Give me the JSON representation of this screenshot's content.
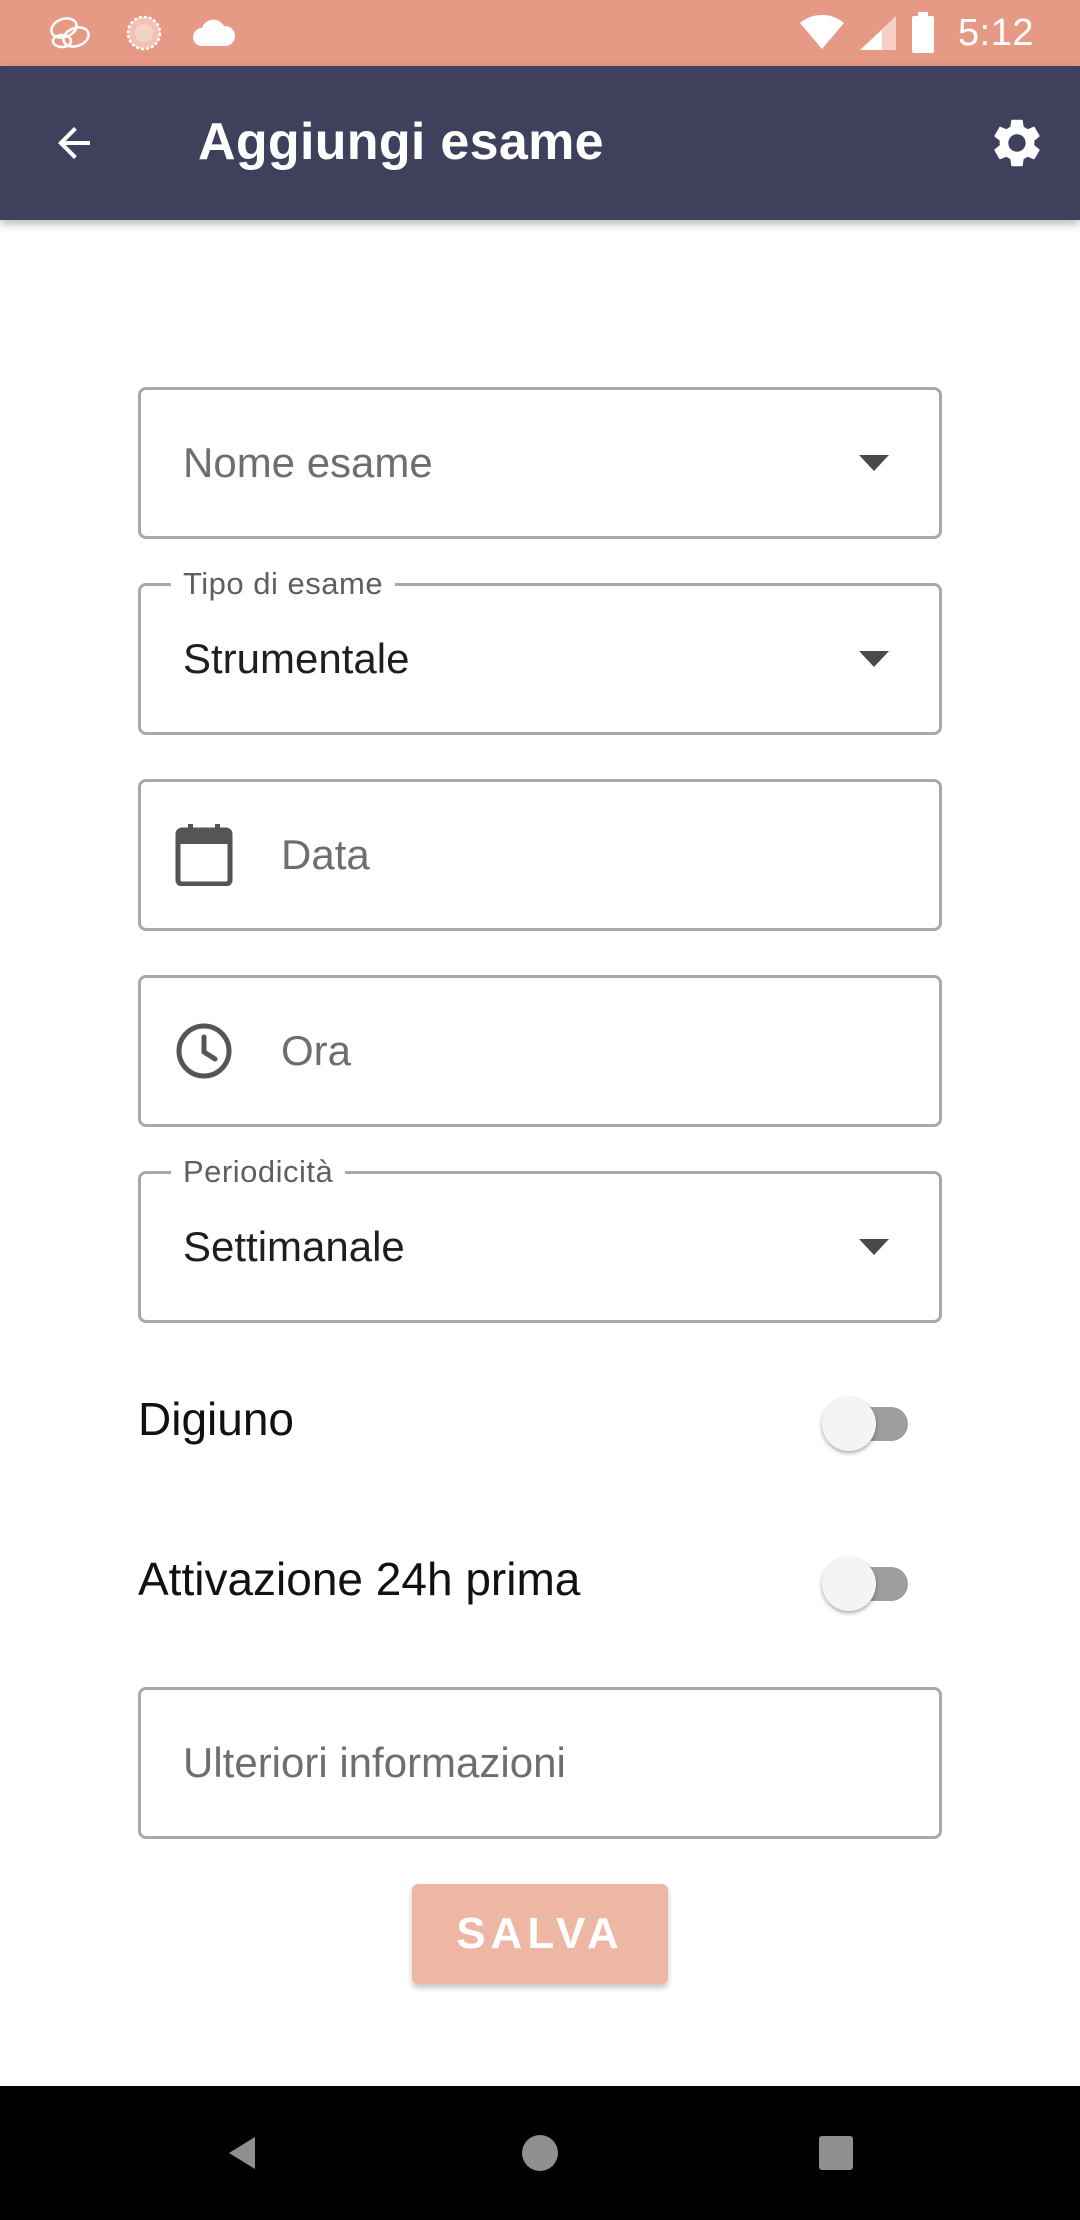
{
  "status_bar": {
    "time": "5:12",
    "left_icons": [
      "app-notification-icon",
      "sun-icon",
      "cloud-icon"
    ],
    "right_icons": [
      "wifi-icon",
      "cellular-signal-icon",
      "battery-icon"
    ]
  },
  "app_bar": {
    "title": "Aggiungi esame",
    "back_icon": "arrow-back-icon",
    "settings_icon": "gear-icon"
  },
  "form": {
    "exam_name": {
      "placeholder": "Nome esame",
      "value": ""
    },
    "exam_type": {
      "label": "Tipo di esame",
      "value": "Strumentale"
    },
    "date": {
      "placeholder": "Data",
      "icon": "calendar-icon"
    },
    "time": {
      "placeholder": "Ora",
      "icon": "clock-icon"
    },
    "periodicity": {
      "label": "Periodicità",
      "value": "Settimanale"
    },
    "fasting": {
      "label": "Digiuno",
      "checked": false
    },
    "activation_24h": {
      "label": "Attivazione 24h prima",
      "checked": false
    },
    "notes": {
      "placeholder": "Ulteriori informazioni",
      "value": ""
    },
    "save_label": "SALVA"
  },
  "colors": {
    "status_bar": "#e69a85",
    "app_bar": "#3e405c",
    "save_button": "#edb7a3",
    "field_border": "#a9a9a9"
  },
  "nav_bar": {
    "icons": [
      "back-triangle-icon",
      "home-circle-icon",
      "recents-square-icon"
    ]
  }
}
